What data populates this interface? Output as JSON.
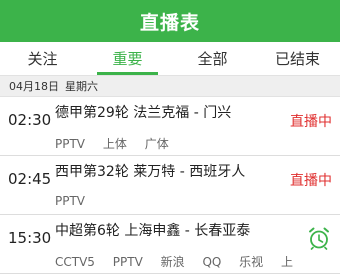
{
  "header": {
    "title": "直播表"
  },
  "tabs": [
    {
      "label": "关注",
      "active": false
    },
    {
      "label": "重要",
      "active": true
    },
    {
      "label": "全部",
      "active": false
    },
    {
      "label": "已结束",
      "active": false
    }
  ],
  "date": {
    "day": "04月18日",
    "weekday": "星期六"
  },
  "matches": [
    {
      "time": "02:30",
      "title": "德甲第29轮 法兰克福 - 门兴",
      "channels": [
        "PPTV",
        "上体",
        "广体"
      ],
      "status": "直播中"
    },
    {
      "time": "02:45",
      "title": "西甲第32轮 莱万特 - 西班牙人",
      "channels": [
        "PPTV"
      ],
      "status": "直播中"
    },
    {
      "time": "15:30",
      "title": "中超第6轮 上海申鑫 - 长春亚泰",
      "channels": [
        "CCTV5",
        "PPTV",
        "新浪",
        "QQ",
        "乐视",
        "上"
      ],
      "icon": "alarm-clock-icon"
    }
  ],
  "colors": {
    "accent": "#3cb34a",
    "live": "#e03030"
  }
}
